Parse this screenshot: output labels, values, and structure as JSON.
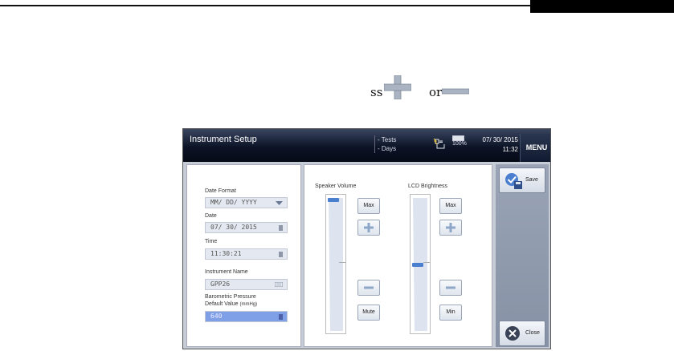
{
  "document": {
    "text_left": "ss",
    "text_right": "or"
  },
  "screen": {
    "title": "Instrument Setup",
    "status": {
      "tests_label": "- Tests",
      "days_label": "- Days",
      "battery_percent": "100%",
      "date": "07/ 30/ 2015",
      "time": "11:32"
    },
    "menu_label": "MENU",
    "fields": {
      "date_format_label": "Date Format",
      "date_format_value": "MM/ DD/ YYYY",
      "date_label": "Date",
      "date_value": "07/ 30/ 2015",
      "time_label": "Time",
      "time_value": "11:30:21",
      "instrument_name_label": "Instrument Name",
      "instrument_name_value": "GPP26",
      "baro_label_line1": "Barometric Pressure",
      "baro_label_line2": "Default Value",
      "baro_unit": "(mmHg)",
      "baro_value": "640"
    },
    "speaker": {
      "title": "Speaker Volume",
      "max_label": "Max",
      "mute_label": "Mute",
      "level": 1.0
    },
    "lcd": {
      "title": "LCD Brightness",
      "max_label": "Max",
      "min_label": "Min",
      "level": 0.5
    },
    "save_label": "Save",
    "close_label": "Close"
  },
  "colors": {
    "accent": "#4a7fd0",
    "active_field": "#7f9fe6",
    "titlebar": "#0c1326"
  }
}
